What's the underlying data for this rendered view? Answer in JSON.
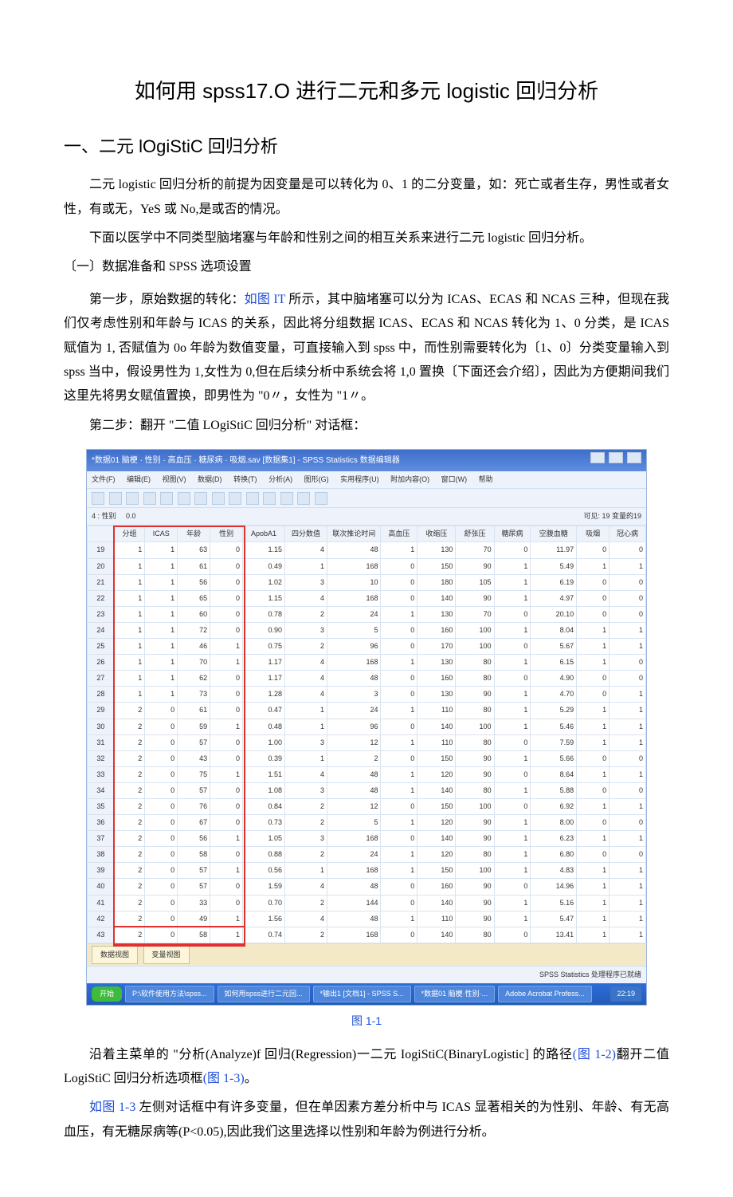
{
  "title": "如何用 spss17.O 进行二元和多元 logistic 回归分析",
  "section1_heading": "一、二元 lOgiStiC 回归分析",
  "p1": "二元 logistic 回归分析的前提为因变量是可以转化为 0、1 的二分变量，如：死亡或者生存，男性或者女性，有或无，YeS 或 No,是或否的情况。",
  "p2": "下面以医学中不同类型脑堵塞与年龄和性别之间的相互关系来进行二元 logistic 回归分析。",
  "sub1": "〔一〕数据准备和 SPSS 选项设置",
  "p3a": "第一步，原始数据的转化：",
  "p3_link": "如图 IT",
  "p3b": " 所示，其中脑堵塞可以分为 ICAS、ECAS 和 NCAS 三种，但现在我们仅考虑性别和年龄与 ICAS 的关系，因此将分组数据 ICAS、ECAS 和 NCAS 转化为 1、0 分类，是 ICAS 赋值为 1, 否赋值为 0o 年龄为数值变量，可直接输入到 spss 中，而性别需要转化为〔1、0〕分类变量输入到 spss 当中，假设男性为 1,女性为 0,但在后续分析中系统会将 1,0 置换〔下面还会介绍〕，因此为方便期间我们这里先将男女赋值置换，即男性为 \"0〃，女性为 \"1〃。",
  "p4": "第二步：翻开 \"二值 LOgiStiC 回归分析\" 对话框：",
  "caption1": "图 1-1",
  "p5a": "沿着主菜单的 \"分析(Analyze)f 回归(Regression)一二元 IogiStiC(BinaryLogistic] 的路径",
  "p5_link1": "(图 1-2)",
  "p5b": "翻开二值 LogiStiC 回归分析选项框",
  "p5_link2": "(图 1-3)",
  "p5c": "。",
  "p6_link": "如图 1-3",
  "p6": " 左侧对话框中有许多变量，但在单因素方差分析中与 ICAS 显著相关的为性别、年龄、有无高血压，有无糖尿病等(P<0.05),因此我们这里选择以性别和年龄为例进行分析。",
  "shot": {
    "window_title": "*数据01 脑梗 · 性别 · 高血压 · 糖尿病 · 吸烟.sav [数据集1] - SPSS Statistics 数据编辑器",
    "menus": [
      "文件(F)",
      "编辑(E)",
      "视图(V)",
      "数据(D)",
      "转换(T)",
      "分析(A)",
      "图形(G)",
      "实用程序(U)",
      "附加内容(O)",
      "窗口(W)",
      "帮助"
    ],
    "info_left_label": "4 : 性别",
    "info_left_value": "0.0",
    "info_right": "可见: 19 变量的19",
    "headers": [
      "",
      "分组",
      "ICAS",
      "年龄",
      "性别",
      "ApobA1",
      "四分数值",
      "联次推论时间",
      "高血压",
      "收缩压",
      "舒张压",
      "糖尿病",
      "空腹血糖",
      "吸烟",
      "冠心病"
    ],
    "rows": [
      [
        "19",
        "1",
        "1",
        "63",
        "0",
        "1.15",
        "4",
        "48",
        "1",
        "130",
        "70",
        "0",
        "11.97",
        "0",
        "0"
      ],
      [
        "20",
        "1",
        "1",
        "61",
        "0",
        "0.49",
        "1",
        "168",
        "0",
        "150",
        "90",
        "1",
        "5.49",
        "1",
        "1"
      ],
      [
        "21",
        "1",
        "1",
        "56",
        "0",
        "1.02",
        "3",
        "10",
        "0",
        "180",
        "105",
        "1",
        "6.19",
        "0",
        "0"
      ],
      [
        "22",
        "1",
        "1",
        "65",
        "0",
        "1.15",
        "4",
        "168",
        "0",
        "140",
        "90",
        "1",
        "4.97",
        "0",
        "0"
      ],
      [
        "23",
        "1",
        "1",
        "60",
        "0",
        "0.78",
        "2",
        "24",
        "1",
        "130",
        "70",
        "0",
        "20.10",
        "0",
        "0"
      ],
      [
        "24",
        "1",
        "1",
        "72",
        "0",
        "0.90",
        "3",
        "5",
        "0",
        "160",
        "100",
        "1",
        "8.04",
        "1",
        "1"
      ],
      [
        "25",
        "1",
        "1",
        "46",
        "1",
        "0.75",
        "2",
        "96",
        "0",
        "170",
        "100",
        "0",
        "5.67",
        "1",
        "1"
      ],
      [
        "26",
        "1",
        "1",
        "70",
        "1",
        "1.17",
        "4",
        "168",
        "1",
        "130",
        "80",
        "1",
        "6.15",
        "1",
        "0"
      ],
      [
        "27",
        "1",
        "1",
        "62",
        "0",
        "1.17",
        "4",
        "48",
        "0",
        "160",
        "80",
        "0",
        "4.90",
        "0",
        "0"
      ],
      [
        "28",
        "1",
        "1",
        "73",
        "0",
        "1.28",
        "4",
        "3",
        "0",
        "130",
        "90",
        "1",
        "4.70",
        "0",
        "1"
      ],
      [
        "29",
        "2",
        "0",
        "61",
        "0",
        "0.47",
        "1",
        "24",
        "1",
        "110",
        "80",
        "1",
        "5.29",
        "1",
        "1"
      ],
      [
        "30",
        "2",
        "0",
        "59",
        "1",
        "0.48",
        "1",
        "96",
        "0",
        "140",
        "100",
        "1",
        "5.46",
        "1",
        "1"
      ],
      [
        "31",
        "2",
        "0",
        "57",
        "0",
        "1.00",
        "3",
        "12",
        "1",
        "110",
        "80",
        "0",
        "7.59",
        "1",
        "1"
      ],
      [
        "32",
        "2",
        "0",
        "43",
        "0",
        "0.39",
        "1",
        "2",
        "0",
        "150",
        "90",
        "1",
        "5.66",
        "0",
        "0"
      ],
      [
        "33",
        "2",
        "0",
        "75",
        "1",
        "1.51",
        "4",
        "48",
        "1",
        "120",
        "90",
        "0",
        "8.64",
        "1",
        "1"
      ],
      [
        "34",
        "2",
        "0",
        "57",
        "0",
        "1.08",
        "3",
        "48",
        "1",
        "140",
        "80",
        "1",
        "5.88",
        "0",
        "0"
      ],
      [
        "35",
        "2",
        "0",
        "76",
        "0",
        "0.84",
        "2",
        "12",
        "0",
        "150",
        "100",
        "0",
        "6.92",
        "1",
        "1"
      ],
      [
        "36",
        "2",
        "0",
        "67",
        "0",
        "0.73",
        "2",
        "5",
        "1",
        "120",
        "90",
        "1",
        "8.00",
        "0",
        "0"
      ],
      [
        "37",
        "2",
        "0",
        "56",
        "1",
        "1.05",
        "3",
        "168",
        "0",
        "140",
        "90",
        "1",
        "6.23",
        "1",
        "1"
      ],
      [
        "38",
        "2",
        "0",
        "58",
        "0",
        "0.88",
        "2",
        "24",
        "1",
        "120",
        "80",
        "1",
        "6.80",
        "0",
        "0"
      ],
      [
        "39",
        "2",
        "0",
        "57",
        "1",
        "0.56",
        "1",
        "168",
        "1",
        "150",
        "100",
        "1",
        "4.83",
        "1",
        "1"
      ],
      [
        "40",
        "2",
        "0",
        "57",
        "0",
        "1.59",
        "4",
        "48",
        "0",
        "160",
        "90",
        "0",
        "14.96",
        "1",
        "1"
      ],
      [
        "41",
        "2",
        "0",
        "33",
        "0",
        "0.70",
        "2",
        "144",
        "0",
        "140",
        "90",
        "1",
        "5.16",
        "1",
        "1"
      ],
      [
        "42",
        "2",
        "0",
        "49",
        "1",
        "1.56",
        "4",
        "48",
        "1",
        "110",
        "90",
        "1",
        "5.47",
        "1",
        "1"
      ],
      [
        "43",
        "2",
        "0",
        "58",
        "1",
        "0.74",
        "2",
        "168",
        "0",
        "140",
        "80",
        "0",
        "13.41",
        "1",
        "1"
      ]
    ],
    "tab1": "数据视图",
    "tab2": "变量视图",
    "status": "SPSS Statistics 处理程序已就绪",
    "taskbar_start": "开始",
    "taskbar_items": [
      "P:\\软件使用方法\\spss...",
      "如何用spss进行二元回...",
      "*输出1 [文档1] - SPSS S...",
      "*数据01 脑梗·性别·...",
      "Adobe Acrobat Profess..."
    ],
    "taskbar_time": "22:19"
  }
}
